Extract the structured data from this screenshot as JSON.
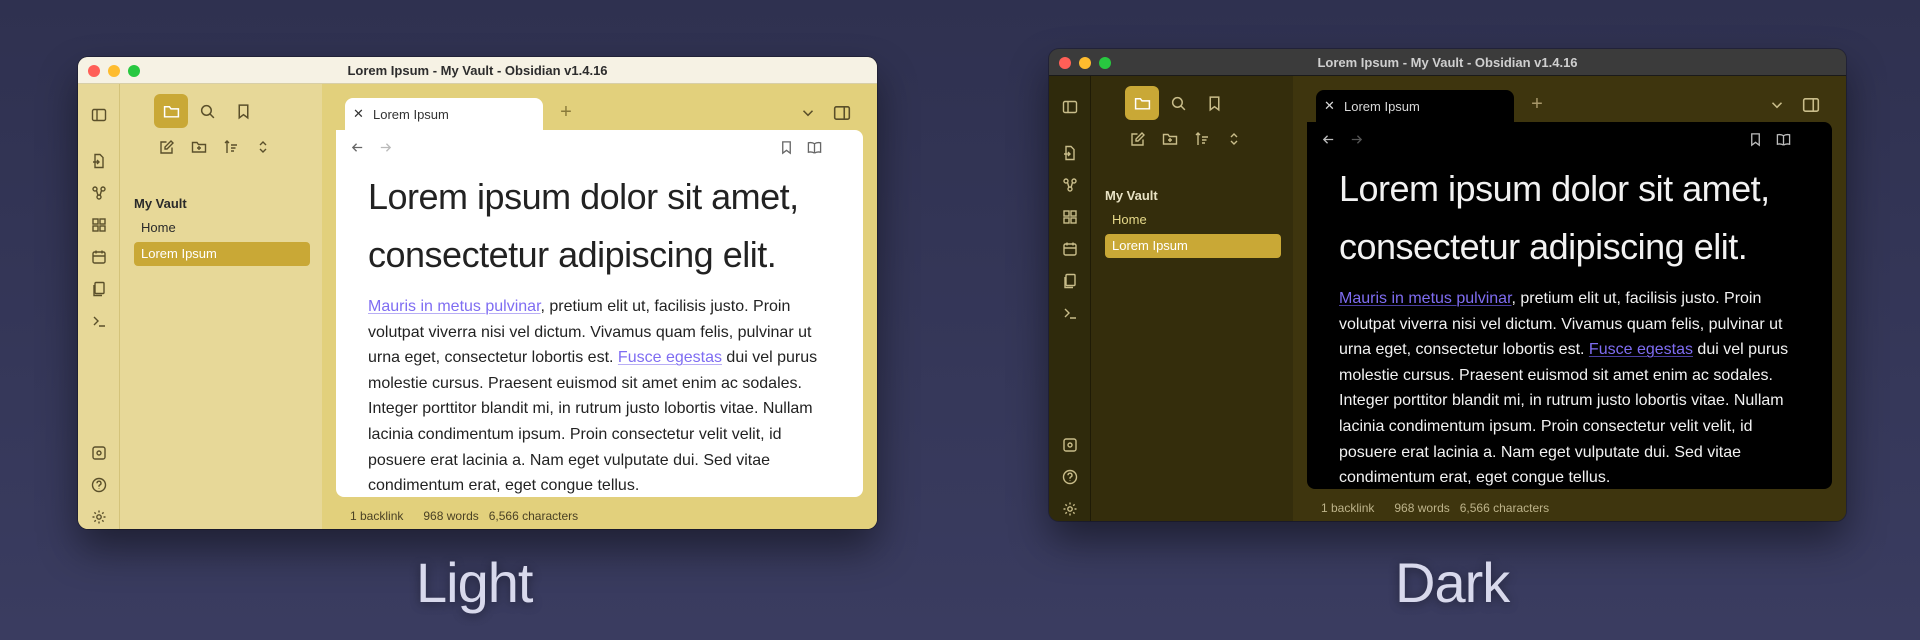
{
  "window_title": "Lorem Ipsum - My Vault - Obsidian v1.4.16",
  "vault_name": "My Vault",
  "files": [
    "Home",
    "Lorem Ipsum"
  ],
  "active_file": "Lorem Ipsum",
  "tab_title": "Lorem Ipsum",
  "heading": "Lorem ipsum dolor sit amet, consectetur adipiscing elit.",
  "paragraph": {
    "link1": "Mauris in metus pulvinar",
    "text1": ", pretium elit ut, facilisis justo. Proin volutpat viverra nisi vel dictum. Vivamus quam felis, pulvinar ut urna eget, consectetur lobortis est. ",
    "link2": "Fusce egestas",
    "text2": " dui vel purus molestie cursus. Praesent euismod sit amet enim ac sodales. Integer porttitor blandit mi, in rutrum justo lobortis vitae. Nullam lacinia condimentum ipsum. Proin consectetur velit velit, id posuere erat lacinia a. Nam eget vulputate dui. Sed vitae condimentum erat, eget congue tellus."
  },
  "status": {
    "backlinks": "1 backlink",
    "words": "968 words",
    "characters": "6,566 characters"
  },
  "labels": {
    "light": "Light",
    "dark": "Dark"
  },
  "colors": {
    "accent": "#c9a836",
    "link": "#7f6df2",
    "light_bg": "#e7d898",
    "dark_bg": "#342d0c"
  }
}
